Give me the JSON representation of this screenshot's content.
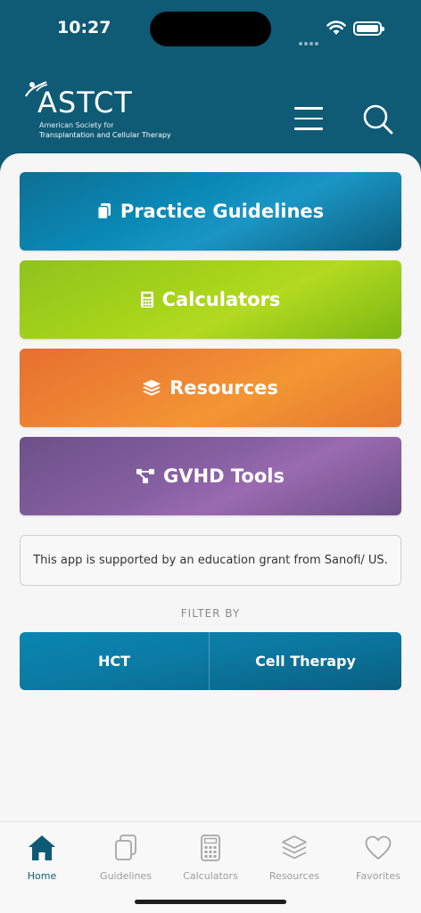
{
  "status": {
    "time": "10:27"
  },
  "header": {
    "logo_text": "ASTCT",
    "logo_line1": "American Society for",
    "logo_line2": "Transplantation and Cellular Therapy"
  },
  "menu_cards": [
    {
      "label": "Practice Guidelines",
      "icon": "documents-icon"
    },
    {
      "label": "Calculators",
      "icon": "calculator-icon"
    },
    {
      "label": "Resources",
      "icon": "layers-icon"
    },
    {
      "label": "GVHD Tools",
      "icon": "network-icon"
    }
  ],
  "notice": "This app is supported by an education grant from Sanofi/ US.",
  "filter": {
    "label": "FILTER BY",
    "options": [
      "HCT",
      "Cell Therapy"
    ]
  },
  "tabs": [
    {
      "label": "Home",
      "icon": "home-icon",
      "active": true
    },
    {
      "label": "Guidelines",
      "icon": "documents-icon"
    },
    {
      "label": "Calculators",
      "icon": "calculator-icon"
    },
    {
      "label": "Resources",
      "icon": "layers-icon"
    },
    {
      "label": "Favorites",
      "icon": "heart-icon"
    }
  ],
  "colors": {
    "header_bg": "#0f5a74",
    "guidelines": "#0a89b6",
    "calculators": "#a8d51a",
    "resources": "#f08a34",
    "gvhd": "#8660a2",
    "active_tab": "#0e5a74"
  }
}
